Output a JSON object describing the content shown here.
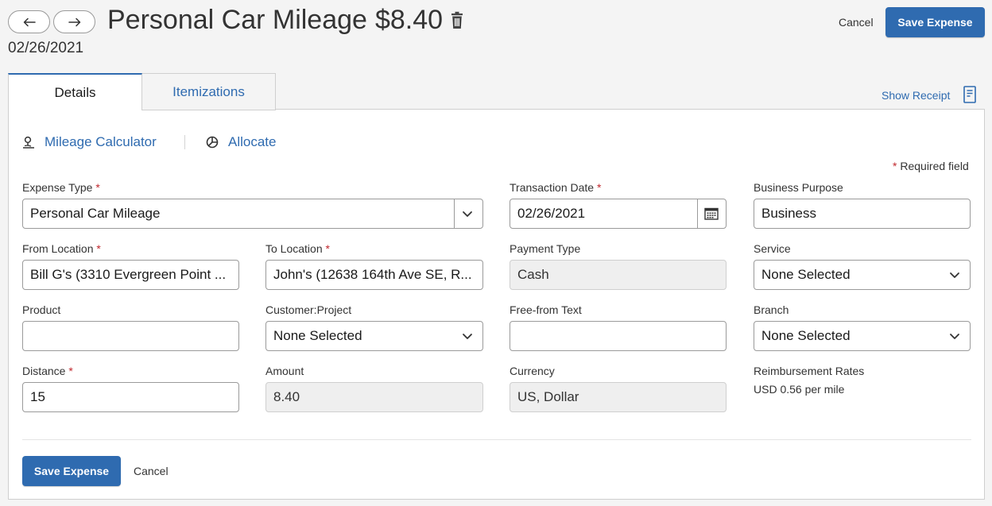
{
  "header": {
    "title": "Personal Car Mileage",
    "amount": "$8.40",
    "date": "02/26/2021",
    "cancel_label": "Cancel",
    "save_label": "Save Expense"
  },
  "tabs": [
    {
      "label": "Details",
      "active": true
    },
    {
      "label": "Itemizations",
      "active": false
    }
  ],
  "show_receipt_label": "Show Receipt",
  "tools": {
    "mileage_calculator": "Mileage Calculator",
    "allocate": "Allocate"
  },
  "required_note": "Required field",
  "form": {
    "expense_type": {
      "label": "Expense Type",
      "value": "Personal Car Mileage"
    },
    "transaction_date": {
      "label": "Transaction Date",
      "value": "02/26/2021"
    },
    "business_purpose": {
      "label": "Business Purpose",
      "value": "Business"
    },
    "from_location": {
      "label": "From Location",
      "value": "Bill G's (3310 Evergreen Point ..."
    },
    "to_location": {
      "label": "To Location",
      "value": "John's (12638 164th Ave SE, R..."
    },
    "payment_type": {
      "label": "Payment Type",
      "value": "Cash"
    },
    "service": {
      "label": "Service",
      "value": "None Selected"
    },
    "product": {
      "label": "Product",
      "value": ""
    },
    "customer_project": {
      "label": "Customer:Project",
      "value": "None Selected"
    },
    "free_form_text": {
      "label": "Free-from Text",
      "value": ""
    },
    "branch": {
      "label": "Branch",
      "value": "None Selected"
    },
    "distance": {
      "label": "Distance",
      "value": "15"
    },
    "amount": {
      "label": "Amount",
      "value": "8.40"
    },
    "currency": {
      "label": "Currency",
      "value": "US, Dollar"
    },
    "reimbursement_rates": {
      "label": "Reimbursement Rates",
      "value": "USD 0.56 per mile"
    }
  },
  "footer": {
    "save_label": "Save Expense",
    "cancel_label": "Cancel"
  },
  "colors": {
    "accent": "#2f6bb0",
    "required": "#c0272d"
  }
}
